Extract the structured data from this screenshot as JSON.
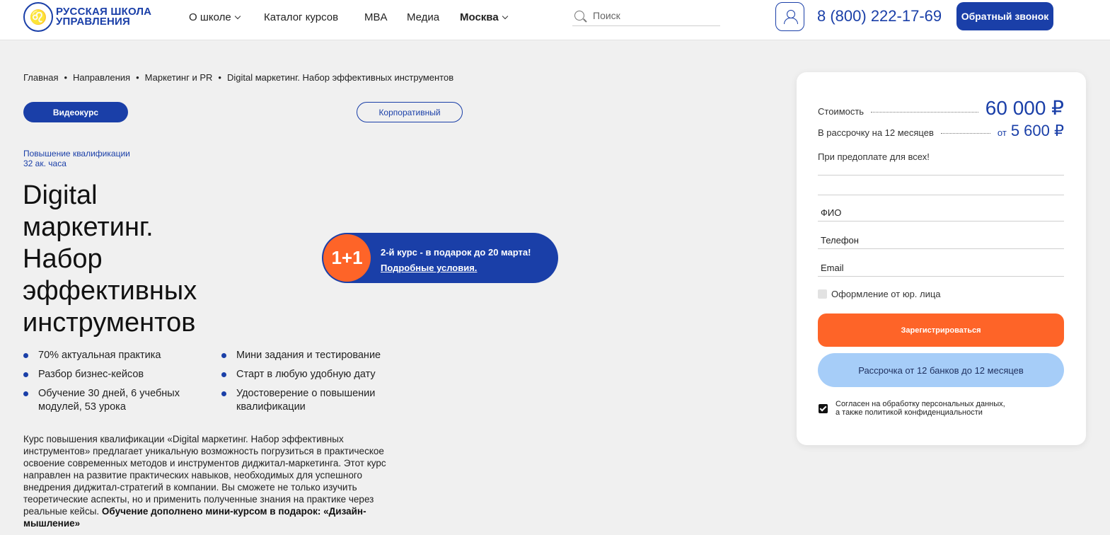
{
  "header": {
    "logo_line1": "РУССКАЯ ШКОЛА",
    "logo_line2": "УПРАВЛЕНИЯ",
    "nav": [
      "О школе",
      "Каталог курсов",
      "MBA",
      "Медиа",
      "Москва"
    ],
    "search_placeholder": "Поиск",
    "phone": "8 (800) 222-17-69",
    "callback_label": "Обратный звонок"
  },
  "breadcrumb": [
    "Главная",
    "Направления",
    "Маркетинг и PR",
    "Digital маркетинг. Набор эффективных инструментов"
  ],
  "pills": {
    "video": "Видеокурс",
    "corporate": "Корпоративный"
  },
  "meta": {
    "type": "Повышение квалификации",
    "hours": "32 ак. часа"
  },
  "title_lines": [
    "Digital",
    "маркетинг.",
    "Набор",
    "эффективных",
    "инструментов"
  ],
  "promo": {
    "badge": "1+1",
    "text": "2-й курс - в подарок до 20 марта!",
    "link": "Подробные условия."
  },
  "features_left": [
    "70% актуальная практика",
    "Разбор бизнес-кейсов",
    "Обучение 30 дней, 6 учебных модулей, 53 урока"
  ],
  "features_right": [
    "Мини задания и тестирование",
    "Старт в любую удобную дату",
    "Удостоверение о повышении квалификации"
  ],
  "description": {
    "text": "Курс повышения квалификации «Digital маркетинг. Набор эффективных инструментов» предлагает уникальную возможность погрузиться в практическое освоение современных методов и инструментов диджитал-маркетинга. Этот курс направлен на развитие практических навыков, необходимых для успешного внедрения диджитал-стратегий в компании. Вы сможете не только изучить теоретические аспекты, но и применить полученные знания на практике через реальные кейсы. ",
    "bold": "Обучение дополнено мини-курсом в подарок: «Дизайн-мышление»"
  },
  "card": {
    "cost_label": "Стоимость",
    "cost_value": "60 000 ₽",
    "installment_label": "В рассрочку на 12 месяцев",
    "installment_prefix": "от",
    "installment_value": "5 600 ₽",
    "prepay": "При предоплате для всех!",
    "fields": [
      "ФИО",
      "Телефон",
      "Email"
    ],
    "legal_entity": "Оформление от юр. лица",
    "register_label": "Зарегистрироваться",
    "installment_button": "Рассрочка от 12 банков до 12 месяцев",
    "consent_line1": "Согласен на обработку персональных данных,",
    "consent_line2": "а также политикой конфиденциальности"
  },
  "colors": {
    "brand": "#1a3fa8",
    "accent": "#fe6428",
    "light_blue": "#a6cdf8",
    "background": "#f0f0f0"
  }
}
